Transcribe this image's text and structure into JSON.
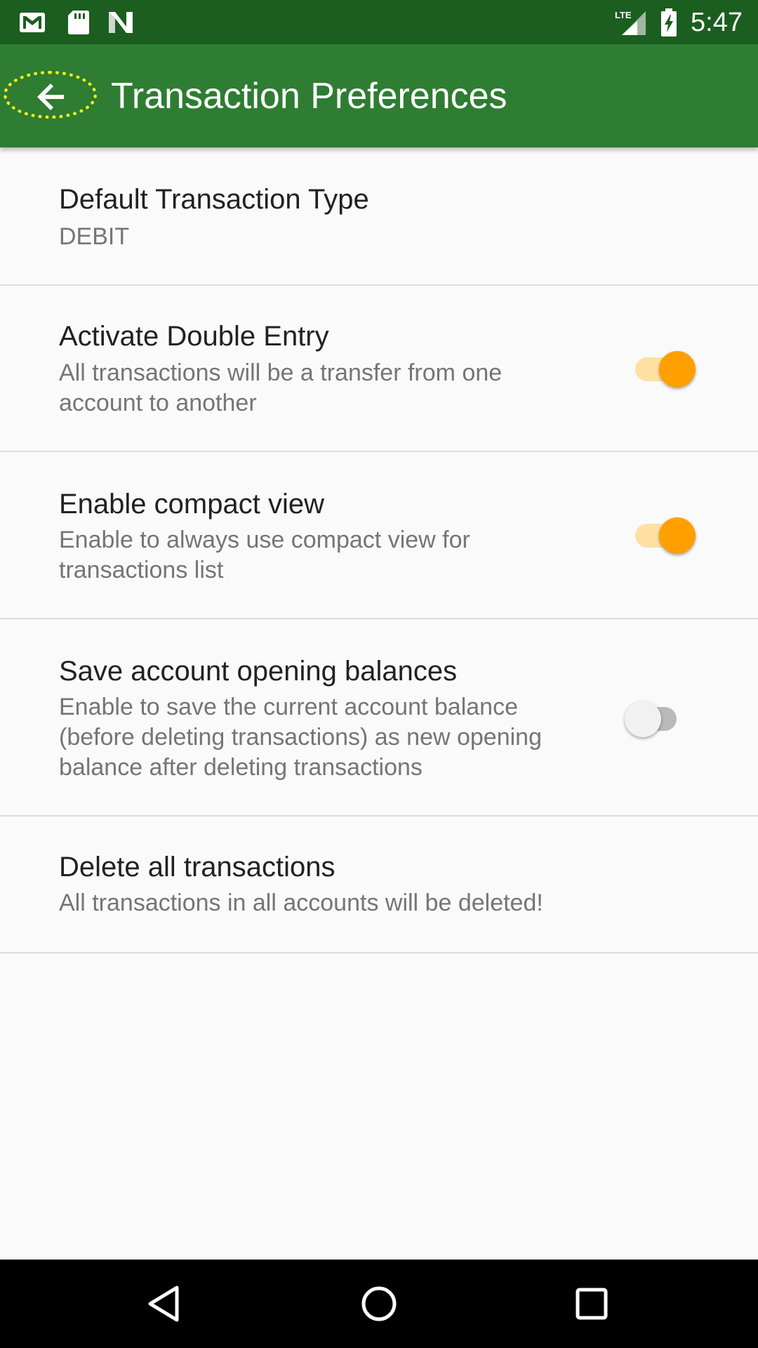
{
  "status_bar": {
    "time": "5:47",
    "network": "LTE",
    "icons": [
      "gmail-icon",
      "sd-card-icon",
      "n-notification-icon",
      "lte-signal-icon",
      "battery-charging-icon"
    ]
  },
  "app_bar": {
    "title": "Transaction Preferences",
    "back_icon": "arrow-back-icon"
  },
  "preferences": {
    "items": [
      {
        "title": "Default Transaction Type",
        "summary": "DEBIT"
      },
      {
        "title": "Activate Double Entry",
        "summary": "All transactions will be a transfer from one account to another",
        "switch_on": true
      },
      {
        "title": "Enable compact view",
        "summary": "Enable to always use compact view for transactions list",
        "switch_on": true
      },
      {
        "title": "Save account opening balances",
        "summary": "Enable to save the current account balance (before deleting transactions) as new opening balance after deleting transactions",
        "switch_on": false
      },
      {
        "title": "Delete all transactions",
        "summary": "All transactions in all accounts will be deleted!"
      }
    ]
  },
  "nav_bar": {
    "icons": [
      "nav-back-icon",
      "nav-home-icon",
      "nav-recents-icon"
    ]
  },
  "colors": {
    "status_bar": "#1b5e20",
    "app_bar": "#2e7d32",
    "switch_on_thumb": "#ffa000",
    "switch_on_track": "#ffe0a3",
    "switch_off_thumb": "#f1f1f1",
    "switch_off_track": "#b9b9b9",
    "background": "#fafafa",
    "highlight_outline": "#f5f01a"
  }
}
